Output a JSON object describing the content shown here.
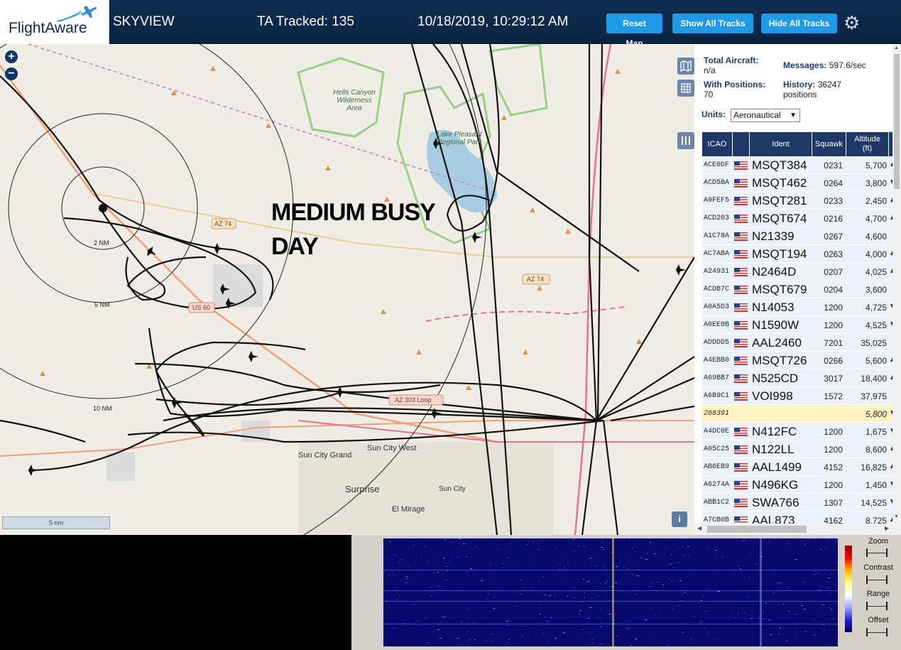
{
  "header": {
    "logo_text": "FlightAware",
    "app_name": "SKYVIEW",
    "tracked": "TA Tracked: 135",
    "datetime": "10/18/2019, 10:29:12 AM",
    "reset_map": "Reset Map",
    "show_all": "Show All Tracks",
    "hide_all": "Hide All Tracks"
  },
  "map": {
    "annotation_line1": "MEDIUM BUSY",
    "annotation_line2": "DAY",
    "labels": {
      "wilderness": "Hells Canyon Wilderness Area",
      "lake": "Lake Pleasant Regional Park",
      "az74a": "AZ 74",
      "az74b": "AZ 74",
      "us60": "US 60",
      "az303": "AZ 303 Loop",
      "sun_city_grand": "Sun City Grand",
      "sun_city_west": "Sun City West",
      "surprise": "Surprise",
      "sun_city": "Sun City",
      "el_mirage": "El Mirage",
      "ring2": "2 NM",
      "ring5": "5 NM",
      "ring10": "10 NM"
    },
    "scale_label": "5 nm",
    "info": "i"
  },
  "panel": {
    "total_aircraft_label": "Total Aircraft:",
    "total_aircraft_value": "n/a",
    "with_positions_label": "With Positions:",
    "with_positions_value": "70",
    "messages_label": "Messages:",
    "messages_value": "597.6/sec",
    "history_label": "History:",
    "history_value": "36247",
    "history_unit": "positions",
    "units_label": "Units:",
    "units_value": "Aeronautical",
    "columns": {
      "icao": "ICAO",
      "ident": "Ident",
      "squawk": "Squawk",
      "altitude": "Altitude",
      "altitude_unit": "(ft)"
    },
    "rows": [
      {
        "icao": "ACE0DF",
        "ident": "MSQT384",
        "squawk": "0231",
        "alt": "5,700",
        "arrow": "▲"
      },
      {
        "icao": "ACD5BA",
        "ident": "MSQT462",
        "squawk": "0264",
        "alt": "3,800",
        "arrow": "▼"
      },
      {
        "icao": "A9FEF5",
        "ident": "MSQT281",
        "squawk": "0233",
        "alt": "2,450",
        "arrow": "▲"
      },
      {
        "icao": "ACD203",
        "ident": "MSQT674",
        "squawk": "0216",
        "alt": "4,700",
        "arrow": "▲"
      },
      {
        "icao": "A1C78A",
        "ident": "N21339",
        "squawk": "0267",
        "alt": "4,600",
        "arrow": ""
      },
      {
        "icao": "AC7ABA",
        "ident": "MSQT194",
        "squawk": "0263",
        "alt": "4,000",
        "arrow": "▲"
      },
      {
        "icao": "A24931",
        "ident": "N2464D",
        "squawk": "0207",
        "alt": "4,025",
        "arrow": "▲"
      },
      {
        "icao": "ACDB7C",
        "ident": "MSQT679",
        "squawk": "0204",
        "alt": "3,600",
        "arrow": ""
      },
      {
        "icao": "A0A5D3",
        "ident": "N14053",
        "squawk": "1200",
        "alt": "4,725",
        "arrow": "▼"
      },
      {
        "icao": "A0EE0B",
        "ident": "N1590W",
        "squawk": "1200",
        "alt": "4,525",
        "arrow": "▼"
      },
      {
        "icao": "ADDDD5",
        "ident": "AAL2460",
        "squawk": "7201",
        "alt": "35,025",
        "arrow": ""
      },
      {
        "icao": "A4EBB0",
        "ident": "MSQT726",
        "squawk": "0266",
        "alt": "5,600",
        "arrow": "▲"
      },
      {
        "icao": "A69BB7",
        "ident": "N525CD",
        "squawk": "3017",
        "alt": "18,400",
        "arrow": "▲"
      },
      {
        "icao": "A6B9C1",
        "ident": "VOI998",
        "squawk": "1572",
        "alt": "37,975",
        "arrow": ""
      },
      {
        "icao": "268391",
        "ident": "",
        "squawk": "",
        "alt": "5,800",
        "arrow": "▼",
        "selected": true
      },
      {
        "icao": "A4DC0E",
        "ident": "N412FC",
        "squawk": "1200",
        "alt": "1,675",
        "arrow": "▼"
      },
      {
        "icao": "A05C25",
        "ident": "N122LL",
        "squawk": "1200",
        "alt": "8,600",
        "arrow": "▲"
      },
      {
        "icao": "AB6EB9",
        "ident": "AAL1499",
        "squawk": "4152",
        "alt": "16,825",
        "arrow": "▲"
      },
      {
        "icao": "A6274A",
        "ident": "N496KG",
        "squawk": "1200",
        "alt": "1,450",
        "arrow": "▼"
      },
      {
        "icao": "ABB1C2",
        "ident": "SWA766",
        "squawk": "1307",
        "alt": "14,525",
        "arrow": "▼"
      },
      {
        "icao": "A7CB0B",
        "ident": "AAL873",
        "squawk": "4162",
        "alt": "8,725",
        "arrow": "▲"
      }
    ]
  },
  "waterfall": {
    "zoom": "Zoom",
    "contrast": "Contrast",
    "range": "Range",
    "offset": "Offset"
  },
  "colors": {
    "header_bg": "#0f2d50",
    "button_blue": "#1f9ae8",
    "table_header": "#1e3766",
    "row_bg": "#eaf2fb",
    "selected_row": "#fff3c4",
    "waterfall_bg": "#07086b"
  },
  "icons": [
    "plane-logo-icon",
    "gear-icon",
    "zoom-in-icon",
    "zoom-out-icon",
    "map-layers-icon",
    "grid-icon",
    "columns-icon",
    "info-icon"
  ]
}
